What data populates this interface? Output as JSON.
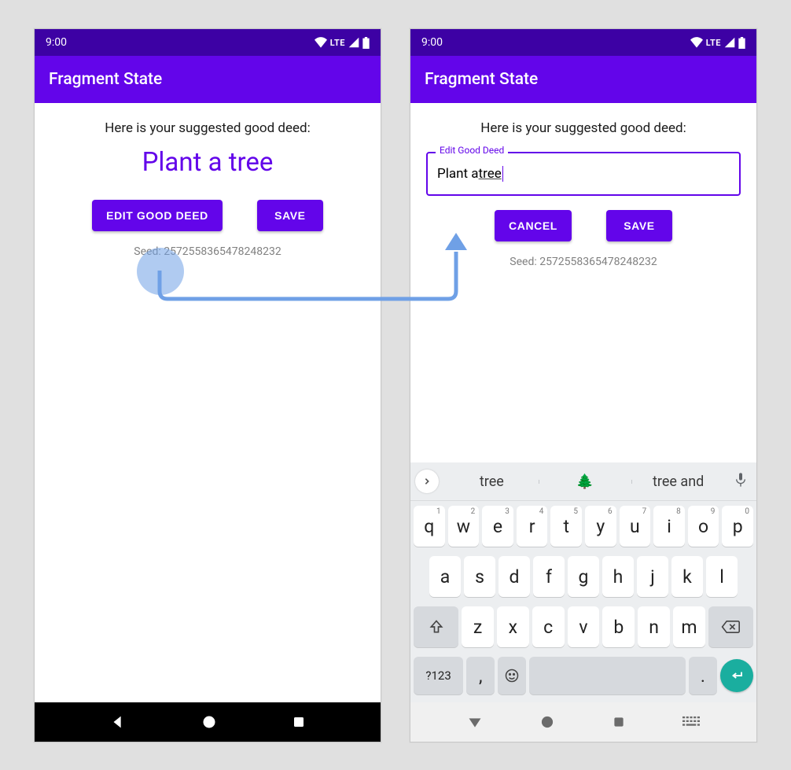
{
  "statusbar": {
    "time": "9:00",
    "net_label": "LTE"
  },
  "appbar": {
    "title": "Fragment State"
  },
  "left_screen": {
    "subheading": "Here is your suggested good deed:",
    "deed": "Plant a tree",
    "buttons": {
      "edit": "EDIT GOOD DEED",
      "save": "SAVE"
    },
    "seed": "Seed: 2572558365478248232"
  },
  "right_screen": {
    "subheading": "Here is your suggested good deed:",
    "field_label": "Edit Good Deed",
    "field_prefix": "Plant a ",
    "field_underlined": "tree",
    "buttons": {
      "cancel": "CANCEL",
      "save": "SAVE"
    },
    "seed": "Seed: 2572558365478248232"
  },
  "keyboard": {
    "suggestions": [
      "tree",
      "🌲",
      "tree and"
    ],
    "row1": [
      {
        "k": "q",
        "h": "1"
      },
      {
        "k": "w",
        "h": "2"
      },
      {
        "k": "e",
        "h": "3"
      },
      {
        "k": "r",
        "h": "4"
      },
      {
        "k": "t",
        "h": "5"
      },
      {
        "k": "y",
        "h": "6"
      },
      {
        "k": "u",
        "h": "7"
      },
      {
        "k": "i",
        "h": "8"
      },
      {
        "k": "o",
        "h": "9"
      },
      {
        "k": "p",
        "h": "0"
      }
    ],
    "row2": [
      "a",
      "s",
      "d",
      "f",
      "g",
      "h",
      "j",
      "k",
      "l"
    ],
    "row3": [
      "z",
      "x",
      "c",
      "v",
      "b",
      "n",
      "m"
    ],
    "symkey": "?123",
    "comma": ",",
    "period": "."
  }
}
